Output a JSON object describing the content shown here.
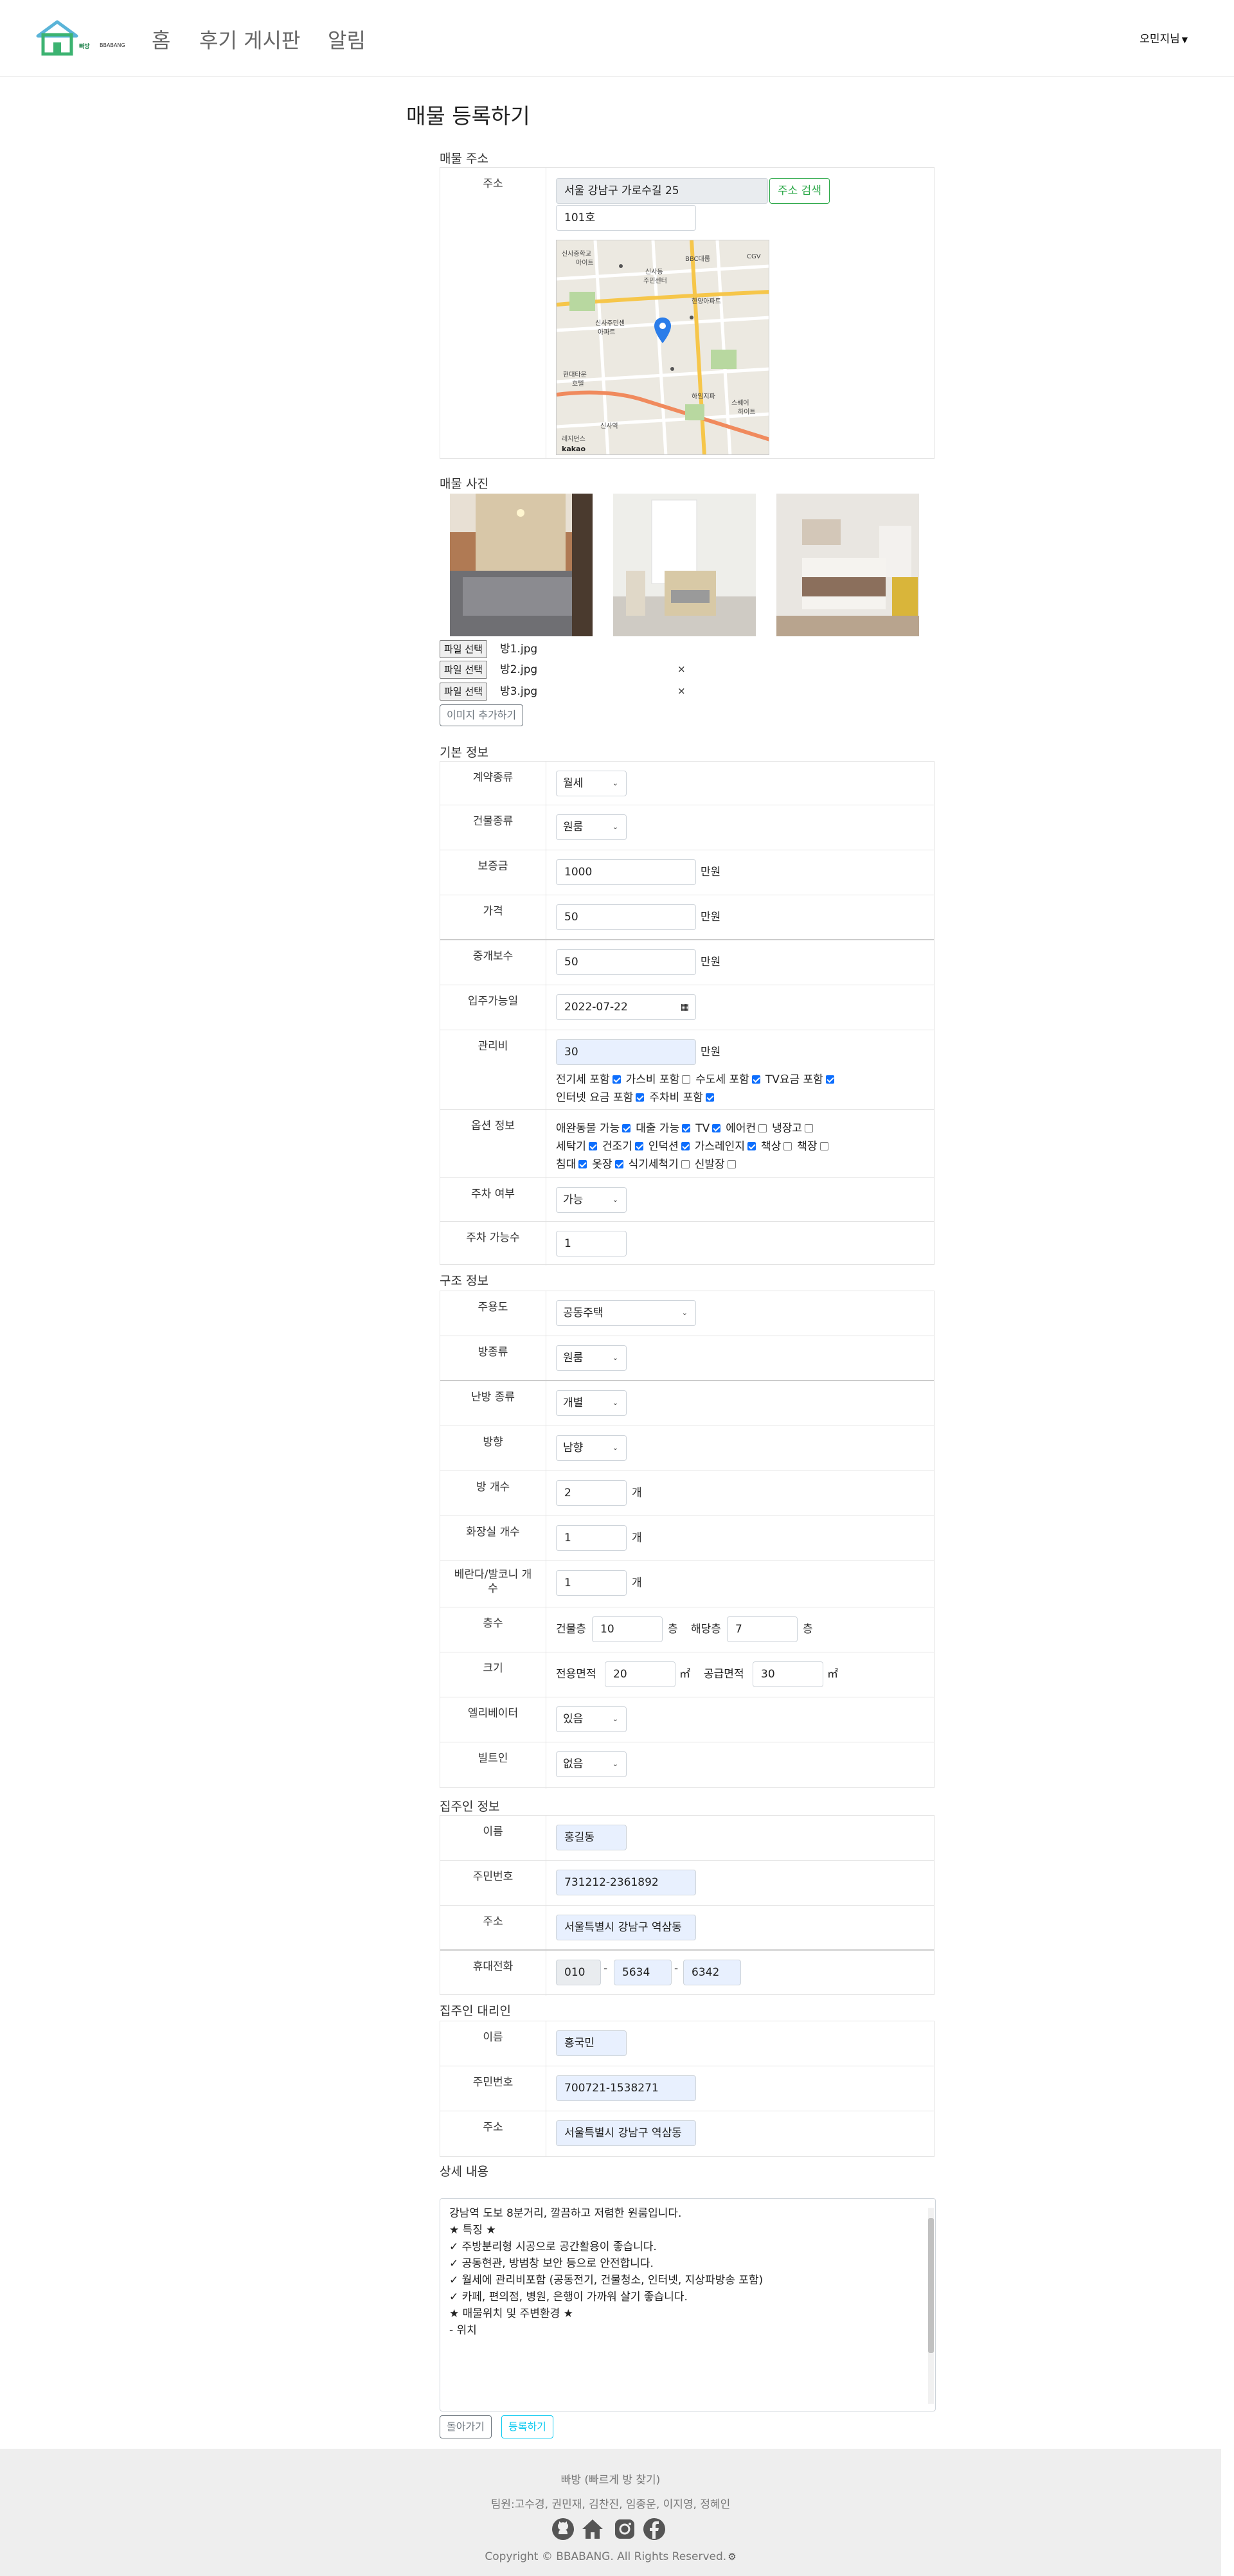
{
  "nav": {
    "logo_text": "빠방",
    "logo_sub": "BBABANG",
    "home": "홈",
    "reviews": "후기 게시판",
    "notice": "알림",
    "user": "오민지님"
  },
  "page": {
    "title": "매물 등록하기"
  },
  "address_section": {
    "title": "매물 주소",
    "label": "주소",
    "address": "서울 강남구 가로수길 25",
    "search_button": "주소 검색",
    "detail": "101호",
    "map_labels": [
      "신사중학교",
      "아이트",
      "BBC대룹",
      "신사동",
      "주민센터",
      "CGV",
      "한양아파트",
      "신사주민센",
      "아파트",
      "현대타운",
      "호텔",
      "하임지파",
      "신사역",
      "스퀘어",
      "하이트",
      "레지던스",
      "kakao"
    ]
  },
  "photos_section": {
    "title": "매물 사진",
    "files": [
      {
        "button": "파일 선택",
        "name": "방1.jpg"
      },
      {
        "button": "파일 선택",
        "name": "방2.jpg",
        "remove": "×"
      },
      {
        "button": "파일 선택",
        "name": "방3.jpg",
        "remove": "×"
      }
    ],
    "add_button": "이미지 추가하기"
  },
  "basic_section": {
    "title": "기본 정보",
    "contract_type": {
      "label": "계약종류",
      "value": "월세"
    },
    "building_type": {
      "label": "건물종류",
      "value": "원룸"
    },
    "deposit": {
      "label": "보증금",
      "value": "1000",
      "unit": "만원"
    },
    "price": {
      "label": "가격",
      "value": "50",
      "unit": "만원"
    },
    "commission": {
      "label": "중개보수",
      "value": "50",
      "unit": "만원"
    },
    "move_in": {
      "label": "입주가능일",
      "value": "2022-07-22"
    },
    "maintenance": {
      "label": "관리비",
      "value": "30",
      "unit": "만원",
      "line1": [
        {
          "text": "전기세 포함",
          "checked": true
        },
        {
          "text": "가스비 포함",
          "checked": false
        },
        {
          "text": "수도세 포함",
          "checked": true
        },
        {
          "text": "TV요금 포함",
          "checked": true
        }
      ],
      "line2": [
        {
          "text": "인터넷 요금 포함",
          "checked": true
        },
        {
          "text": "주차비 포함",
          "checked": true
        }
      ]
    },
    "options": {
      "label": "옵션 정보",
      "line1": [
        {
          "text": "애완동물 가능",
          "checked": true
        },
        {
          "text": "대출 가능",
          "checked": true
        },
        {
          "text": "TV",
          "checked": true
        },
        {
          "text": "에어컨",
          "checked": false
        },
        {
          "text": "냉장고",
          "checked": false
        }
      ],
      "line2": [
        {
          "text": "세탁기",
          "checked": true
        },
        {
          "text": "건조기",
          "checked": true
        },
        {
          "text": "인덕션",
          "checked": true
        },
        {
          "text": "가스레인지",
          "checked": true
        },
        {
          "text": "책상",
          "checked": false
        },
        {
          "text": "책장",
          "checked": false
        }
      ],
      "line3": [
        {
          "text": "침대",
          "checked": true
        },
        {
          "text": "옷장",
          "checked": true
        },
        {
          "text": "식기세척기",
          "checked": false
        },
        {
          "text": "신발장",
          "checked": false
        }
      ]
    },
    "parking": {
      "label": "주차 여부",
      "value": "가능"
    },
    "parking_count": {
      "label": "주차 가능수",
      "value": "1"
    }
  },
  "structure_section": {
    "title": "구조 정보",
    "zoning": {
      "label": "주용도",
      "value": "공동주택"
    },
    "room_type": {
      "label": "방종류",
      "value": "원룸"
    },
    "heating": {
      "label": "난방 종류",
      "value": "개별"
    },
    "direction": {
      "label": "방향",
      "value": "남향"
    },
    "rooms": {
      "label": "방 개수",
      "value": "2",
      "unit": "개"
    },
    "bathrooms": {
      "label": "화장실 개수",
      "value": "1",
      "unit": "개"
    },
    "balcony": {
      "label": "베란다/발코니 개수",
      "value": "1",
      "unit": "개"
    },
    "floors": {
      "label": "층수",
      "building_label": "건물층",
      "building": "10",
      "floor_unit": "층",
      "target_label": "해당층",
      "target": "7",
      "floor_unit2": "층"
    },
    "size": {
      "label": "크기",
      "exclusive_label": "전용면적",
      "exclusive": "20",
      "unit": "㎡",
      "supply_label": "공급면적",
      "supply": "30",
      "unit2": "㎡"
    },
    "elevator": {
      "label": "엘리베이터",
      "value": "있음"
    },
    "builtin": {
      "label": "빌트인",
      "value": "없음"
    }
  },
  "owner_section": {
    "title": "집주인 정보",
    "name": {
      "label": "이름",
      "value": "홍길동"
    },
    "rrn": {
      "label": "주민번호",
      "value": "731212-2361892"
    },
    "address": {
      "label": "주소",
      "value": "서울특별시 강남구 역삼동"
    },
    "phone": {
      "label": "휴대전화",
      "p1": "010",
      "p2": "5634",
      "p3": "6342",
      "sep": "-"
    }
  },
  "agent_section": {
    "title": "집주인 대리인",
    "name": {
      "label": "이름",
      "value": "홍국민"
    },
    "rrn": {
      "label": "주민번호",
      "value": "700721-1538271"
    },
    "address": {
      "label": "주소",
      "value": "서울특별시 강남구 역삼동"
    }
  },
  "detail_section": {
    "title": "상세 내용",
    "lines": [
      "강남역 도보 8분거리, 깔끔하고 저렴한 원룸입니다.",
      "",
      "★ 특징 ★",
      "✓ 주방분리형 시공으로 공간활용이 좋습니다.",
      "✓ 공동현관, 방범창 보안 등으로 안전합니다.",
      "✓ 월세에 관리비포함 (공동전기, 건물청소, 인터넷, 지상파방송 포함)",
      "✓ 카페, 편의점, 병원, 은행이 가까워 살기 좋습니다.",
      "",
      "★ 매물위치 및 주변환경 ★",
      "- 위치"
    ]
  },
  "actions": {
    "back": "돌아가기",
    "submit": "등록하기"
  },
  "footer": {
    "line1": "빠방 (빠르게 방 찾기)",
    "line2": "팀원:고수경, 권민재, 김찬진, 임종운, 이지영, 정혜인",
    "copyright": "Copyright © BBABANG. All Rights Reserved."
  }
}
